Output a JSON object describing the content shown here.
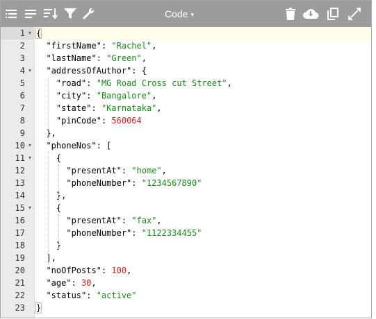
{
  "toolbar": {
    "mode_label": "Code",
    "mode_caret": "▾",
    "icons": [
      "format-icon",
      "compact-icon",
      "sort-icon",
      "filter-icon",
      "repair-icon",
      "delete-icon",
      "download-icon",
      "copy-icon",
      "fullscreen-icon"
    ]
  },
  "editor": {
    "active_line": 1,
    "lines": [
      {
        "n": "1",
        "fold": "▾",
        "tokens": [
          {
            "t": "{",
            "c": "p",
            "bm": true
          }
        ]
      },
      {
        "n": "2",
        "fold": "",
        "tokens": [
          {
            "t": "  ",
            "c": "p"
          },
          {
            "t": "\"firstName\"",
            "c": "k"
          },
          {
            "t": ": ",
            "c": "p"
          },
          {
            "t": "\"Rachel\"",
            "c": "s"
          },
          {
            "t": ",",
            "c": "p"
          }
        ]
      },
      {
        "n": "3",
        "fold": "",
        "tokens": [
          {
            "t": "  ",
            "c": "p"
          },
          {
            "t": "\"lastName\"",
            "c": "k"
          },
          {
            "t": ": ",
            "c": "p"
          },
          {
            "t": "\"Green\"",
            "c": "s"
          },
          {
            "t": ",",
            "c": "p"
          }
        ]
      },
      {
        "n": "4",
        "fold": "▾",
        "tokens": [
          {
            "t": "  ",
            "c": "p"
          },
          {
            "t": "\"addressOfAuthor\"",
            "c": "k"
          },
          {
            "t": ": {",
            "c": "p"
          }
        ]
      },
      {
        "n": "5",
        "fold": "",
        "tokens": [
          {
            "t": "    ",
            "c": "p"
          },
          {
            "t": "\"road\"",
            "c": "k"
          },
          {
            "t": ": ",
            "c": "p"
          },
          {
            "t": "\"MG Road Cross cut Street\"",
            "c": "s"
          },
          {
            "t": ",",
            "c": "p"
          }
        ]
      },
      {
        "n": "6",
        "fold": "",
        "tokens": [
          {
            "t": "    ",
            "c": "p"
          },
          {
            "t": "\"city\"",
            "c": "k"
          },
          {
            "t": ": ",
            "c": "p"
          },
          {
            "t": "\"Bangalore\"",
            "c": "s"
          },
          {
            "t": ",",
            "c": "p"
          }
        ]
      },
      {
        "n": "7",
        "fold": "",
        "tokens": [
          {
            "t": "    ",
            "c": "p"
          },
          {
            "t": "\"state\"",
            "c": "k"
          },
          {
            "t": ": ",
            "c": "p"
          },
          {
            "t": "\"Karnataka\"",
            "c": "s"
          },
          {
            "t": ",",
            "c": "p"
          }
        ]
      },
      {
        "n": "8",
        "fold": "",
        "tokens": [
          {
            "t": "    ",
            "c": "p"
          },
          {
            "t": "\"pinCode\"",
            "c": "k"
          },
          {
            "t": ": ",
            "c": "p"
          },
          {
            "t": "560064",
            "c": "n"
          }
        ]
      },
      {
        "n": "9",
        "fold": "",
        "tokens": [
          {
            "t": "  },",
            "c": "p"
          }
        ]
      },
      {
        "n": "10",
        "fold": "▾",
        "tokens": [
          {
            "t": "  ",
            "c": "p"
          },
          {
            "t": "\"phoneNos\"",
            "c": "k"
          },
          {
            "t": ": [",
            "c": "p"
          }
        ]
      },
      {
        "n": "11",
        "fold": "▾",
        "tokens": [
          {
            "t": "    {",
            "c": "p"
          }
        ]
      },
      {
        "n": "12",
        "fold": "",
        "tokens": [
          {
            "t": "      ",
            "c": "p"
          },
          {
            "t": "\"presentAt\"",
            "c": "k"
          },
          {
            "t": ": ",
            "c": "p"
          },
          {
            "t": "\"home\"",
            "c": "s"
          },
          {
            "t": ",",
            "c": "p"
          }
        ]
      },
      {
        "n": "13",
        "fold": "",
        "tokens": [
          {
            "t": "      ",
            "c": "p"
          },
          {
            "t": "\"phoneNumber\"",
            "c": "k"
          },
          {
            "t": ": ",
            "c": "p"
          },
          {
            "t": "\"1234567890\"",
            "c": "s"
          }
        ]
      },
      {
        "n": "14",
        "fold": "",
        "tokens": [
          {
            "t": "    },",
            "c": "p"
          }
        ]
      },
      {
        "n": "15",
        "fold": "▾",
        "tokens": [
          {
            "t": "    {",
            "c": "p"
          }
        ]
      },
      {
        "n": "16",
        "fold": "",
        "tokens": [
          {
            "t": "      ",
            "c": "p"
          },
          {
            "t": "\"presentAt\"",
            "c": "k"
          },
          {
            "t": ": ",
            "c": "p"
          },
          {
            "t": "\"fax\"",
            "c": "s"
          },
          {
            "t": ",",
            "c": "p"
          }
        ]
      },
      {
        "n": "17",
        "fold": "",
        "tokens": [
          {
            "t": "      ",
            "c": "p"
          },
          {
            "t": "\"phoneNumber\"",
            "c": "k"
          },
          {
            "t": ": ",
            "c": "p"
          },
          {
            "t": "\"1122334455\"",
            "c": "s"
          }
        ]
      },
      {
        "n": "18",
        "fold": "",
        "tokens": [
          {
            "t": "    }",
            "c": "p"
          }
        ]
      },
      {
        "n": "19",
        "fold": "",
        "tokens": [
          {
            "t": "  ],",
            "c": "p"
          }
        ]
      },
      {
        "n": "20",
        "fold": "",
        "tokens": [
          {
            "t": "  ",
            "c": "p"
          },
          {
            "t": "\"noOfPosts\"",
            "c": "k"
          },
          {
            "t": ": ",
            "c": "p"
          },
          {
            "t": "100",
            "c": "n"
          },
          {
            "t": ",",
            "c": "p"
          }
        ]
      },
      {
        "n": "21",
        "fold": "",
        "tokens": [
          {
            "t": "  ",
            "c": "p"
          },
          {
            "t": "\"age\"",
            "c": "k"
          },
          {
            "t": ": ",
            "c": "p"
          },
          {
            "t": "30",
            "c": "n"
          },
          {
            "t": ",",
            "c": "p"
          }
        ]
      },
      {
        "n": "22",
        "fold": "",
        "tokens": [
          {
            "t": "  ",
            "c": "p"
          },
          {
            "t": "\"status\"",
            "c": "k"
          },
          {
            "t": ": ",
            "c": "p"
          },
          {
            "t": "\"active\"",
            "c": "s"
          }
        ]
      },
      {
        "n": "23",
        "fold": "",
        "tokens": [
          {
            "t": "}",
            "c": "p",
            "bm": true
          }
        ]
      }
    ]
  },
  "colors": {
    "toolbar": "#9c9c9c",
    "string": "#1a8a1a",
    "number": "#d02020",
    "gutter": "#ebebeb"
  }
}
